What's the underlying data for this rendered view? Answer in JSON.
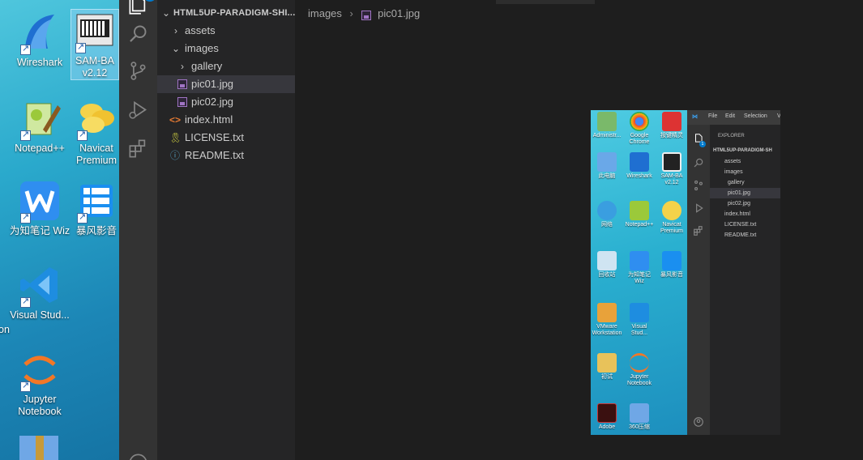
{
  "desktop": {
    "icons": [
      {
        "label": "Wireshark"
      },
      {
        "label": "SAM-BA v2.12"
      },
      {
        "label": "Notepad++"
      },
      {
        "label": "Navicat Premium"
      },
      {
        "label": "为知笔记 Wiz"
      },
      {
        "label": "暴风影音"
      },
      {
        "label": "Visual Stud..."
      },
      {
        "label": "Jupyter Notebook"
      }
    ],
    "edge_text": "on"
  },
  "activity_bar": {
    "explorer_badge": "1",
    "items": [
      "files-icon",
      "search-icon",
      "source-control-icon",
      "run-debug-icon",
      "extensions-icon",
      "accounts-icon"
    ]
  },
  "explorer": {
    "root": "HTML5UP-PARADIGM-SHI...",
    "tree": [
      {
        "label": "assets",
        "kind": "folder",
        "expanded": false
      },
      {
        "label": "images",
        "kind": "folder",
        "expanded": true
      },
      {
        "label": "gallery",
        "kind": "folder",
        "expanded": false
      },
      {
        "label": "pic01.jpg",
        "kind": "image",
        "selected": true
      },
      {
        "label": "pic02.jpg",
        "kind": "image"
      },
      {
        "label": "index.html",
        "kind": "html"
      },
      {
        "label": "LICENSE.txt",
        "kind": "license"
      },
      {
        "label": "README.txt",
        "kind": "info"
      }
    ]
  },
  "editor": {
    "breadcrumb": [
      "images",
      "pic01.jpg"
    ]
  },
  "preview": {
    "menu": [
      "File",
      "Edit",
      "Selection",
      "V"
    ],
    "explorer_title": "EXPLORER",
    "root": "HTML5UP-PARADIGM-SH",
    "tree": [
      "assets",
      "images",
      "gallery",
      "pic01.jpg",
      "pic02.jpg",
      "index.html",
      "LICENSE.txt",
      "README.txt"
    ],
    "desktop_labels": [
      "Administr...",
      "Google Chrome",
      "按键精灵",
      "此电脑",
      "Wireshark",
      "SAM-BA v2.12",
      "网络",
      "Notepad++",
      "Navicat Premium",
      "回收站",
      "为知笔记 Wiz",
      "暴风影音",
      "VMware Workstation",
      "Visual Stud...",
      "初试",
      "Jupyter Notebook",
      "Adobe",
      "360压缩"
    ],
    "badge": "1"
  },
  "colors": {
    "accent": "#007acc",
    "activity_bg": "#333333",
    "sidebar_bg": "#252526",
    "editor_bg": "#1e1e1e",
    "selected_row": "#37373d"
  }
}
